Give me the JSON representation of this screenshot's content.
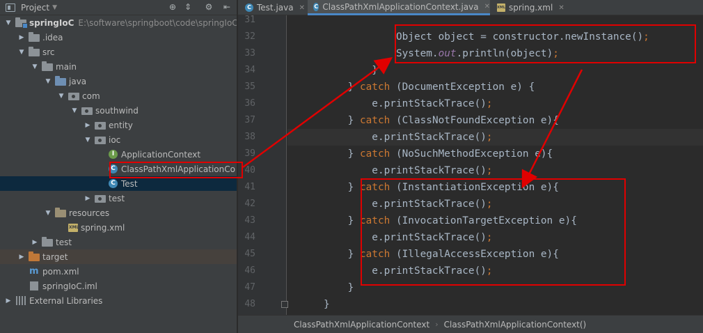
{
  "project_panel": {
    "title": "Project",
    "tree": [
      {
        "label": "springIoC",
        "path": "E:\\software\\springboot\\code\\springIoC",
        "depth": 0,
        "twisty": "open",
        "icon": "module-folder-icon",
        "bold": true
      },
      {
        "label": ".idea",
        "depth": 1,
        "twisty": "closed",
        "icon": "folder-icon"
      },
      {
        "label": "src",
        "depth": 1,
        "twisty": "open",
        "icon": "folder-icon"
      },
      {
        "label": "main",
        "depth": 2,
        "twisty": "open",
        "icon": "folder-icon"
      },
      {
        "label": "java",
        "depth": 3,
        "twisty": "open",
        "icon": "source-folder-icon"
      },
      {
        "label": "com",
        "depth": 4,
        "twisty": "open",
        "icon": "package-icon"
      },
      {
        "label": "southwind",
        "depth": 5,
        "twisty": "open",
        "icon": "package-icon"
      },
      {
        "label": "entity",
        "depth": 6,
        "twisty": "closed",
        "icon": "package-icon"
      },
      {
        "label": "ioc",
        "depth": 6,
        "twisty": "open",
        "icon": "package-icon"
      },
      {
        "label": "ApplicationContext",
        "depth": 7,
        "twisty": "none",
        "icon": "interface-icon"
      },
      {
        "label": "ClassPathXmlApplicationCo",
        "depth": 7,
        "twisty": "none",
        "icon": "class-icon"
      },
      {
        "label": "Test",
        "depth": 7,
        "twisty": "none",
        "icon": "runnable-class-icon",
        "selected": true
      },
      {
        "label": "test",
        "depth": 6,
        "twisty": "closed",
        "icon": "package-icon"
      },
      {
        "label": "resources",
        "depth": 3,
        "twisty": "open",
        "icon": "resources-folder-icon"
      },
      {
        "label": "spring.xml",
        "depth": 4,
        "twisty": "none",
        "icon": "xml-file-icon"
      },
      {
        "label": "test",
        "depth": 2,
        "twisty": "closed",
        "icon": "folder-icon"
      },
      {
        "label": "target",
        "depth": 1,
        "twisty": "closed",
        "icon": "target-folder-icon",
        "highlight": true
      },
      {
        "label": "pom.xml",
        "depth": 1,
        "twisty": "none",
        "icon": "maven-icon"
      },
      {
        "label": "springIoC.iml",
        "depth": 1,
        "twisty": "none",
        "icon": "iml-file-icon"
      },
      {
        "label": "External Libraries",
        "depth": 0,
        "twisty": "closed",
        "icon": "library-icon"
      }
    ]
  },
  "tabs": [
    {
      "label": "Test.java",
      "icon": "class-icon",
      "active": false
    },
    {
      "label": "ClassPathXmlApplicationContext.java",
      "icon": "class-icon",
      "active": true
    },
    {
      "label": "spring.xml",
      "icon": "xml-file-icon",
      "active": false
    }
  ],
  "code": {
    "current_line": 38,
    "lines": [
      {
        "n": 31,
        "parts": []
      },
      {
        "n": 32,
        "parts": [
          [
            "",
            "                  Object object = constructor.newInstance()"
          ],
          [
            "punc",
            ";"
          ]
        ]
      },
      {
        "n": 33,
        "parts": [
          [
            "",
            "                  System."
          ],
          [
            "fld",
            "out"
          ],
          [
            "",
            ".println(object)"
          ],
          [
            "punc",
            ";"
          ]
        ]
      },
      {
        "n": 34,
        "parts": [
          [
            "",
            "              }"
          ]
        ]
      },
      {
        "n": 35,
        "parts": [
          [
            "",
            "          } "
          ],
          [
            "kw",
            "catch"
          ],
          [
            "",
            " (DocumentException e) {"
          ]
        ]
      },
      {
        "n": 36,
        "parts": [
          [
            "",
            "              e.printStackTrace()"
          ],
          [
            "punc",
            ";"
          ]
        ]
      },
      {
        "n": 37,
        "parts": [
          [
            "",
            "          } "
          ],
          [
            "kw",
            "catch"
          ],
          [
            "",
            " (ClassNotFoundException e){"
          ]
        ]
      },
      {
        "n": 38,
        "parts": [
          [
            "",
            "              e.printStackTrace()"
          ],
          [
            "punc",
            ";"
          ]
        ]
      },
      {
        "n": 39,
        "parts": [
          [
            "",
            "          } "
          ],
          [
            "kw",
            "catch"
          ],
          [
            "",
            " (NoSuchMethodException e){"
          ]
        ]
      },
      {
        "n": 40,
        "parts": [
          [
            "",
            "              e.printStackTrace()"
          ],
          [
            "punc",
            ";"
          ]
        ]
      },
      {
        "n": 41,
        "parts": [
          [
            "",
            "          } "
          ],
          [
            "kw",
            "catch"
          ],
          [
            "",
            " (InstantiationException e){"
          ]
        ]
      },
      {
        "n": 42,
        "parts": [
          [
            "",
            "              e.printStackTrace()"
          ],
          [
            "punc",
            ";"
          ]
        ]
      },
      {
        "n": 43,
        "parts": [
          [
            "",
            "          } "
          ],
          [
            "kw",
            "catch"
          ],
          [
            "",
            " (InvocationTargetException e){"
          ]
        ]
      },
      {
        "n": 44,
        "parts": [
          [
            "",
            "              e.printStackTrace()"
          ],
          [
            "punc",
            ";"
          ]
        ]
      },
      {
        "n": 45,
        "parts": [
          [
            "",
            "          } "
          ],
          [
            "kw",
            "catch"
          ],
          [
            "",
            " (IllegalAccessException e){"
          ]
        ]
      },
      {
        "n": 46,
        "parts": [
          [
            "",
            "              e.printStackTrace()"
          ],
          [
            "punc",
            ";"
          ]
        ]
      },
      {
        "n": 47,
        "parts": [
          [
            "",
            "          }"
          ]
        ]
      },
      {
        "n": 48,
        "parts": [
          [
            "",
            "      }"
          ]
        ]
      }
    ]
  },
  "breadcrumbs": [
    "ClassPathXmlApplicationContext",
    "ClassPathXmlApplicationContext()"
  ],
  "colors": {
    "annotation_red": "#e00000",
    "keyword": "#cc7832",
    "field": "#9876aa",
    "selection": "#0d293e"
  }
}
